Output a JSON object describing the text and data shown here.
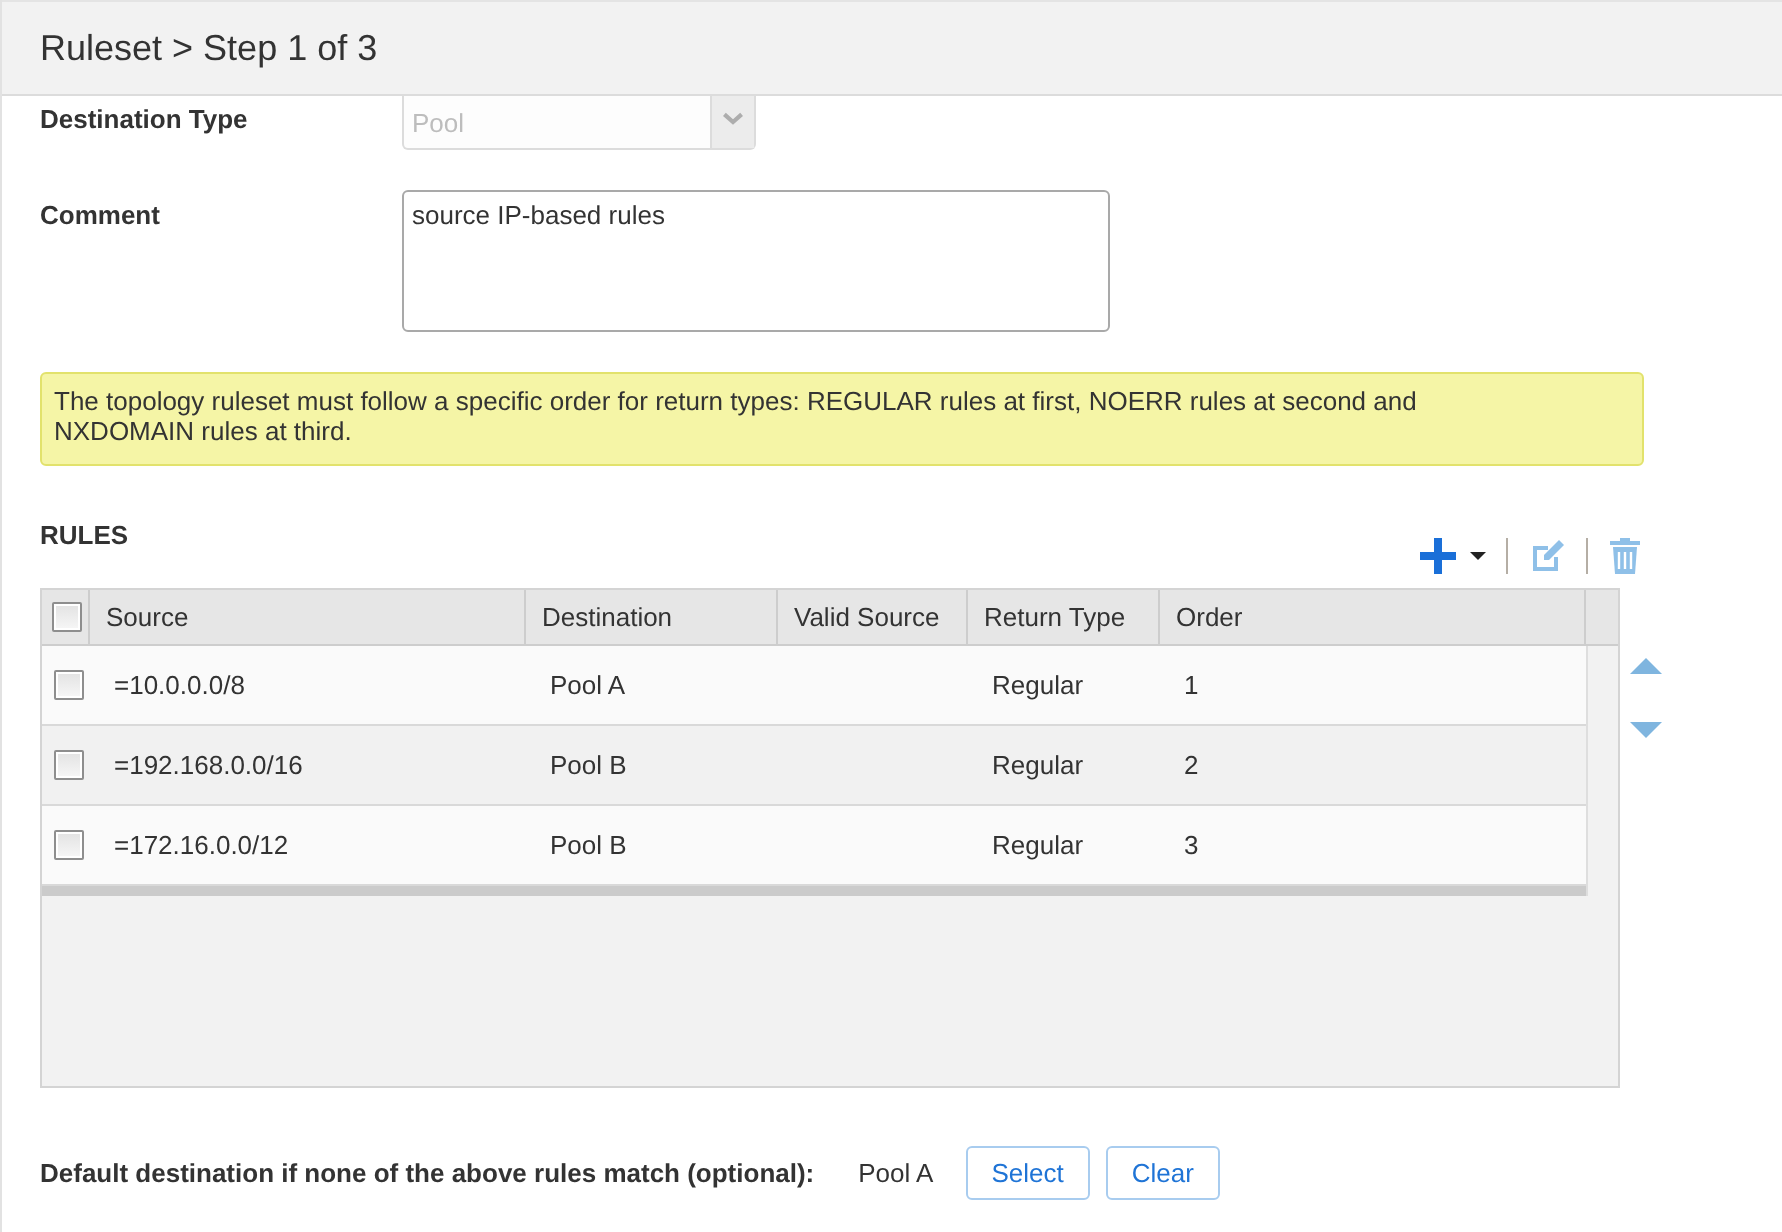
{
  "header": {
    "title": "Ruleset > Step 1 of 3"
  },
  "form": {
    "destination_type": {
      "label": "Destination Type",
      "value": "Pool",
      "disabled": true
    },
    "comment": {
      "label": "Comment",
      "value": "source IP-based rules"
    }
  },
  "notice": "The topology ruleset must follow a specific order for return types: REGULAR rules at first, NOERR rules at second and NXDOMAIN rules at third.",
  "rules": {
    "title": "RULES",
    "toolbar": [
      {
        "kind": "add",
        "disabled": false
      },
      {
        "kind": "edit",
        "disabled": true
      },
      {
        "kind": "delete",
        "disabled": true
      }
    ],
    "select_all": {
      "checked": false
    },
    "columns": [
      "Source",
      "Destination",
      "Valid Source",
      "Return Type",
      "Order"
    ],
    "rows": [
      {
        "checked": false,
        "source": "=10.0.0.0/8",
        "destination": "Pool A",
        "return_type": "Regular",
        "order": "1"
      },
      {
        "checked": false,
        "source": "=192.168.0.0/16",
        "destination": "Pool B",
        "return_type": "Regular",
        "order": "2"
      },
      {
        "checked": false,
        "source": "=172.16.0.0/12",
        "destination": "Pool B",
        "return_type": "Regular",
        "order": "3"
      }
    ],
    "reorder": [
      {
        "kind": "up",
        "disabled": true
      },
      {
        "kind": "down",
        "disabled": true
      }
    ]
  },
  "default_destination": {
    "label": "Default destination if none of the above rules match (optional):",
    "value": "Pool A",
    "buttons": [
      "Select",
      "Clear"
    ]
  }
}
